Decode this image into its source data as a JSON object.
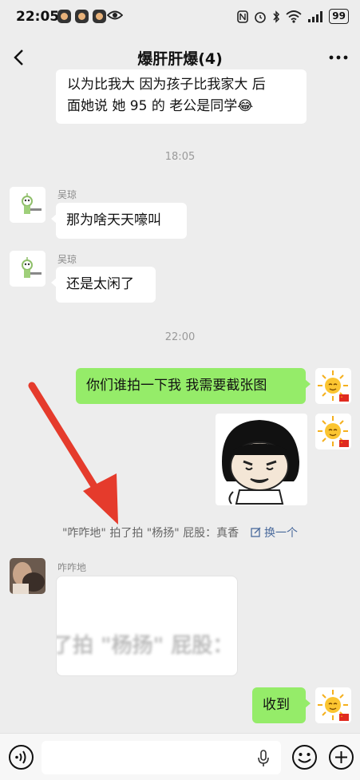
{
  "status_bar": {
    "time": "22:05",
    "battery": "99"
  },
  "header": {
    "title": "爆肝肝爆(4)"
  },
  "messages": {
    "top_bubble_line1": "以为比我大 因为孩子比我家大  后",
    "top_bubble_line2": "面她说 她 95 的 老公是同学😂",
    "timestamp1": "18:05",
    "msg1_sender": "吴琼",
    "msg1_text": "那为啥天天嚎叫",
    "msg2_sender": "吴琼",
    "msg2_text": "还是太闲了",
    "timestamp2": "22:00",
    "msg3_text": "你们谁拍一下我 我需要截张图",
    "system_notice": "\"咋咋地\" 拍了拍 \"杨扬\" 屁股：真香",
    "system_swap": "换一个",
    "msg5_sender": "咋咋地",
    "msg5_image_text": "了拍 \"杨扬\" 屁股：",
    "msg6_text": "收到"
  },
  "input_bar": {
    "placeholder": ""
  },
  "icons": {
    "back": "back-arrow-icon",
    "more": "more-dots-icon",
    "voice": "voice-input-icon",
    "mic": "microphone-icon",
    "emoji": "emoji-icon",
    "plus": "plus-icon"
  },
  "colors": {
    "background": "#ededed",
    "my_bubble": "#95ec69",
    "their_bubble": "#ffffff",
    "arrow_annotation": "#e53b2c"
  }
}
